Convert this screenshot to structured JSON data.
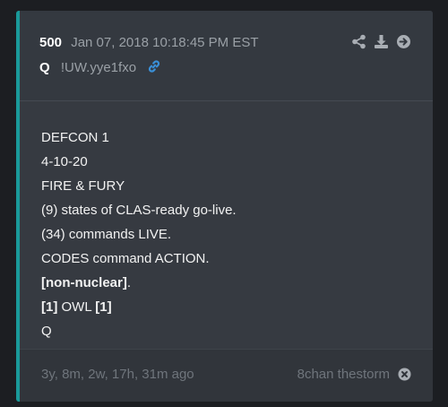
{
  "post": {
    "number": "500",
    "datetime": "Jan 07, 2018 10:18:45 PM EST",
    "author": "Q",
    "tripcode": "!UW.yye1fxo",
    "body": [
      {
        "parts": [
          {
            "text": "DEFCON 1",
            "bold": false
          }
        ]
      },
      {
        "parts": [
          {
            "text": "4-10-20",
            "bold": false
          }
        ]
      },
      {
        "parts": [
          {
            "text": "FIRE & FURY",
            "bold": false
          }
        ]
      },
      {
        "parts": [
          {
            "text": "(9) states of CLAS-ready go-live.",
            "bold": false
          }
        ]
      },
      {
        "parts": [
          {
            "text": "(34) commands LIVE.",
            "bold": false
          }
        ]
      },
      {
        "parts": [
          {
            "text": "CODES command ACTION.",
            "bold": false
          }
        ]
      },
      {
        "parts": [
          {
            "text": "[non-nuclear]",
            "bold": true
          },
          {
            "text": ".",
            "bold": false
          }
        ]
      },
      {
        "parts": [
          {
            "text": "[1]",
            "bold": true
          },
          {
            "text": " OWL ",
            "bold": false
          },
          {
            "text": "[1]",
            "bold": true
          }
        ]
      },
      {
        "parts": [
          {
            "text": "Q",
            "bold": false
          }
        ]
      }
    ]
  },
  "footer": {
    "ago": "3y, 8m, 2w, 17h, 31m ago",
    "source": "8chan thestorm"
  },
  "icons": {
    "share": "share-icon",
    "download": "download-icon",
    "goto": "arrow-right-circle-icon",
    "link": "link-icon",
    "close": "close-icon"
  },
  "colors": {
    "accent": "#1a9a9a",
    "link": "#3a8fd6",
    "icon": "#a9aeb4"
  }
}
